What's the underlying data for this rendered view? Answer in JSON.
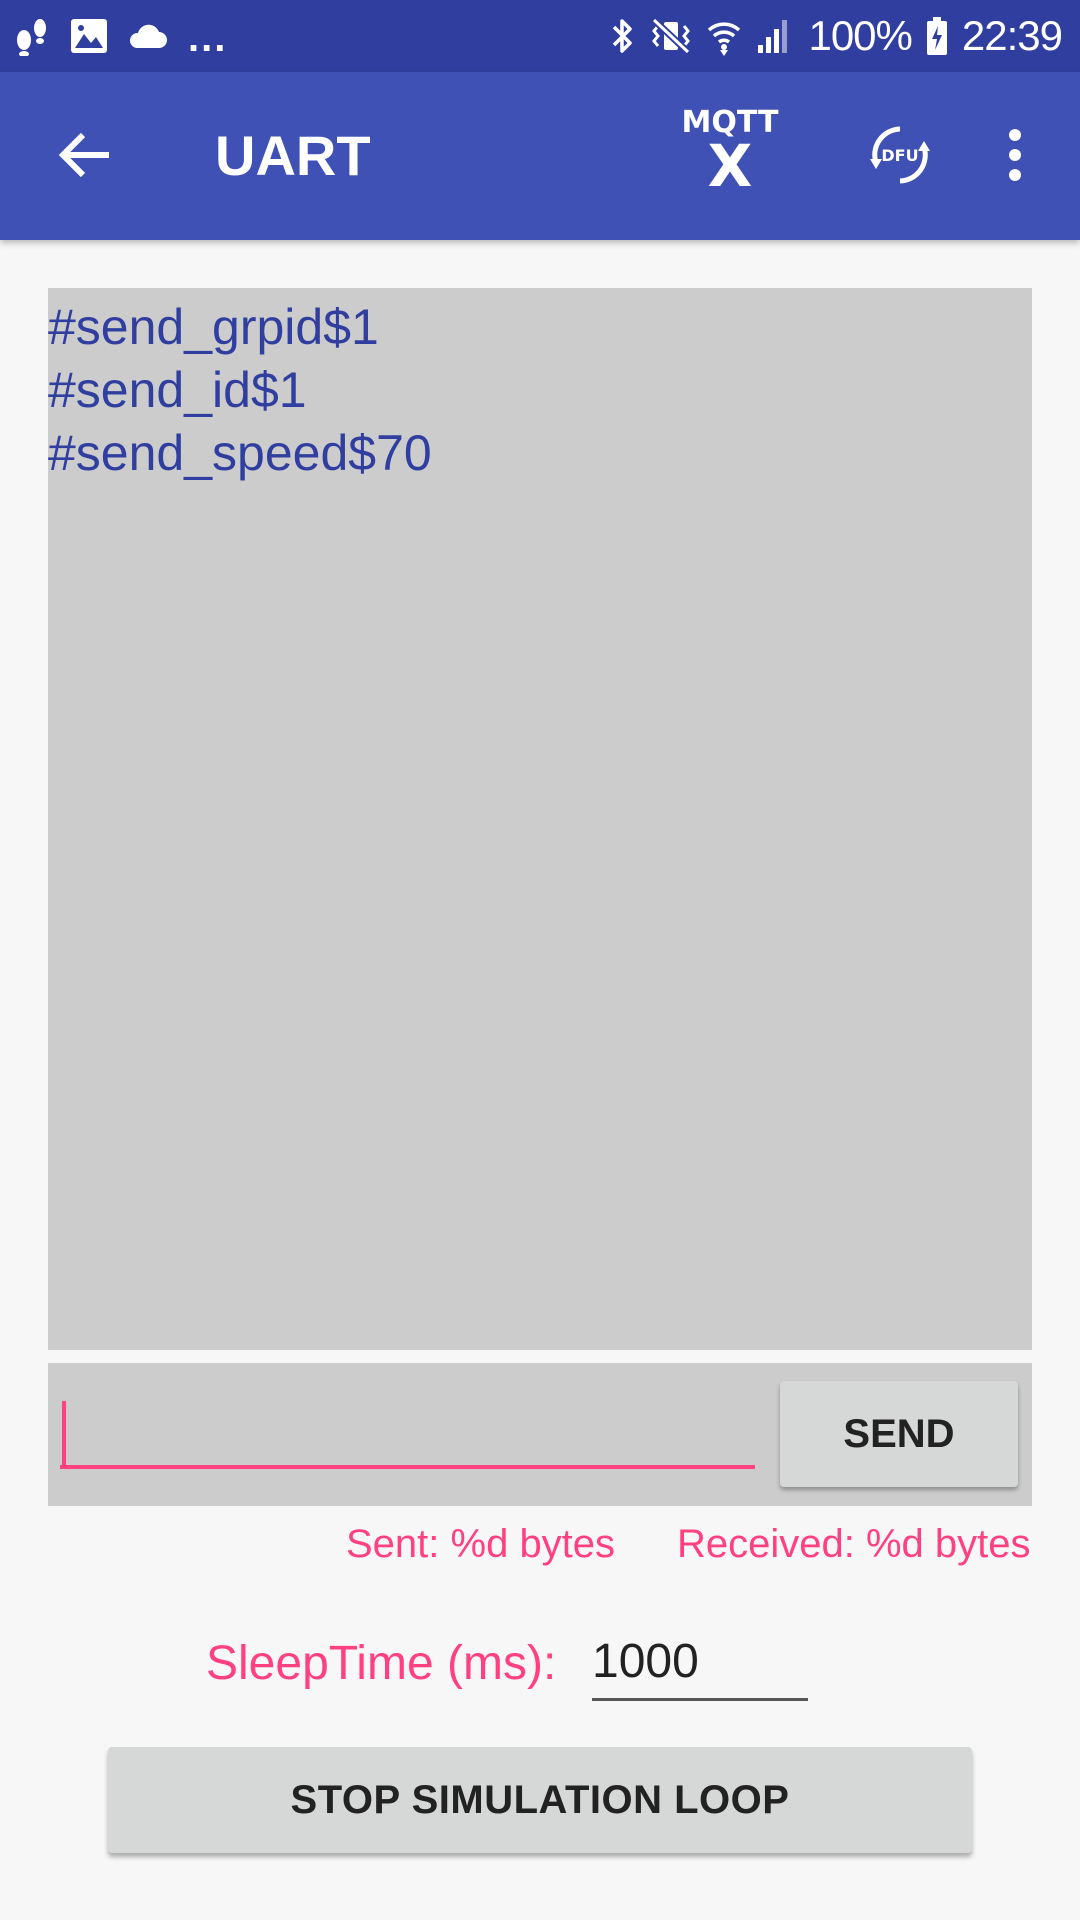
{
  "status_bar": {
    "left_icons": [
      "steps-icon",
      "image-icon",
      "cloud-icon"
    ],
    "overflow": "...",
    "right_icons": [
      "bluetooth-icon",
      "vibrate-icon",
      "wifi-icon",
      "signal-icon"
    ],
    "battery": "100%",
    "time": "22:39"
  },
  "app_bar": {
    "title": "UART",
    "mqtt_label": "MQTT",
    "mqtt_state": "X",
    "dfu_label": "DFU",
    "accent_color": "#3f51b5"
  },
  "console": {
    "lines": [
      "#send_grpid$1",
      "#send_id$1",
      "#send_speed$70"
    ]
  },
  "input": {
    "value": "",
    "send_label": "SEND"
  },
  "counters": {
    "sent": "Sent: %d bytes",
    "received": "Received: %d bytes"
  },
  "sleep": {
    "label": "SleepTime (ms):",
    "value": "1000"
  },
  "stop_button": {
    "label": "STOP SIMULATION LOOP"
  },
  "colors": {
    "status_bar": "#303f9f",
    "console_text": "#303f9f",
    "pink_accent": "#ff4081"
  }
}
